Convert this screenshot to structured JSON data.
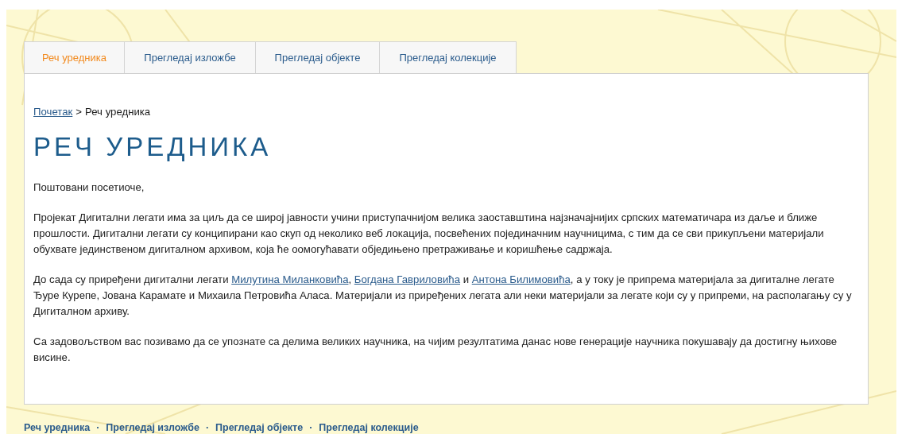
{
  "tabs": [
    {
      "label": "Реч уредника",
      "selected": true
    },
    {
      "label": "Прегледај изложбе",
      "selected": false
    },
    {
      "label": "Прегледај објекте",
      "selected": false
    },
    {
      "label": "Прегледај колекције",
      "selected": false
    }
  ],
  "breadcrumb": {
    "link": "Почетак",
    "separator": ">",
    "current": "Реч уредника"
  },
  "heading": "РЕЧ УРЕДНИКА",
  "paragraphs": [
    [
      {
        "kind": "text",
        "text": "Поштовани посетиоче,"
      }
    ],
    [
      {
        "kind": "text",
        "text": "Пројекат Дигитални легати има за циљ да се широј јавности учини приступачнијом велика заоставштина најзначајнијих српских математичара из даље и ближе прошлости. Дигитални легати су конципирани као скуп од неколико веб локација, посвећених појединачним научницима, с тим да се сви прикупљени материјали обухвате јединственом дигиталном архивом, која ће оомогућавати обједињено претраживање и коришћење садржаја."
      }
    ],
    [
      {
        "kind": "text",
        "text": "До сада су приређени дигитални легати  "
      },
      {
        "kind": "link",
        "text": "Милутина Миланковића"
      },
      {
        "kind": "text",
        "text": ", "
      },
      {
        "kind": "link",
        "text": "Богдана Гавриловића"
      },
      {
        "kind": "text",
        "text": " и "
      },
      {
        "kind": "link",
        "text": "Антона Билимовића"
      },
      {
        "kind": "text",
        "text": ", а у току је припрема материјала за дигиталне легате Ђуре Курепе, Јована Карамате и Михаила Петровића Аласа. Материјали из приређених легата али неки материјали за легате који су у припреми, на располагању су у Дигиталном архиву."
      }
    ],
    [
      {
        "kind": "text",
        "text": "Са задовољством вас позивамо да се упознате са делима великих научника, на чијим резултатима данас нове генерације научника покушавају да достигну њихове висине."
      }
    ]
  ],
  "footer_links": [
    {
      "label": "Реч уредника",
      "separator": "·"
    },
    {
      "label": "Прегледај изложбе",
      "separator": "·"
    },
    {
      "label": "Прегледај објекте",
      "separator": "·"
    },
    {
      "label": "Прегледај колекције"
    }
  ]
}
